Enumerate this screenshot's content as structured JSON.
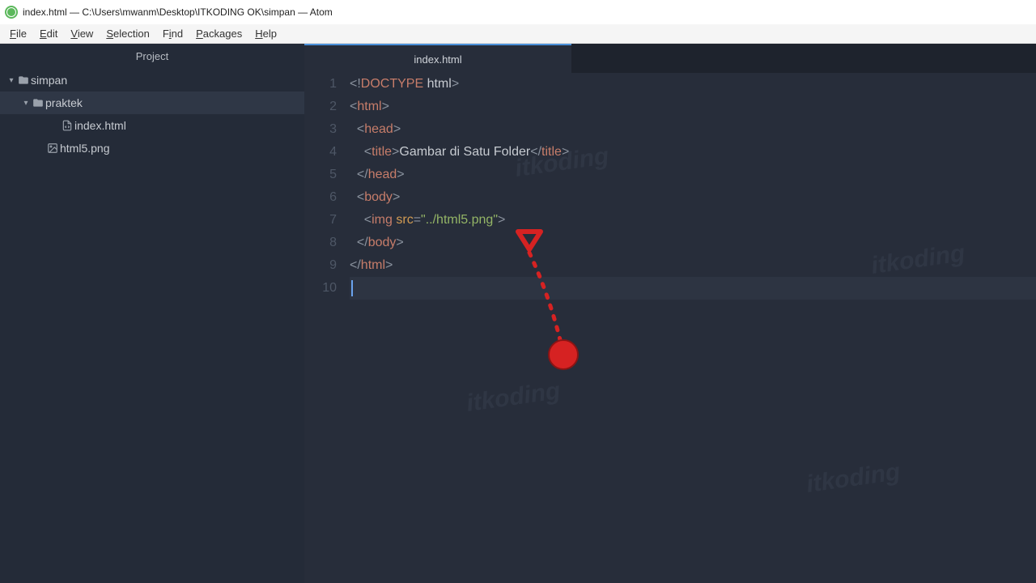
{
  "window": {
    "title": "index.html — C:\\Users\\mwanm\\Desktop\\ITKODING OK\\simpan — Atom"
  },
  "menu": {
    "file": "File",
    "edit": "Edit",
    "view": "View",
    "selection": "Selection",
    "find": "Find",
    "packages": "Packages",
    "help": "Help"
  },
  "sidebar": {
    "header": "Project",
    "items": [
      {
        "label": "simpan",
        "type": "folder",
        "indent": 0,
        "chev": "▾"
      },
      {
        "label": "praktek",
        "type": "folder",
        "indent": 1,
        "chev": "▾",
        "selected": true
      },
      {
        "label": "index.html",
        "type": "file-code",
        "indent": 2
      },
      {
        "label": "html5.png",
        "type": "file-image",
        "indent": 1
      }
    ]
  },
  "tab": {
    "label": "index.html"
  },
  "code": {
    "lines": [
      {
        "n": "1",
        "segs": [
          {
            "c": "p",
            "t": "<!"
          },
          {
            "c": "t",
            "t": "DOCTYPE"
          },
          {
            "c": "tx",
            "t": " html"
          },
          {
            "c": "p",
            "t": ">"
          }
        ]
      },
      {
        "n": "2",
        "segs": [
          {
            "c": "p",
            "t": "<"
          },
          {
            "c": "t",
            "t": "html"
          },
          {
            "c": "p",
            "t": ">"
          }
        ]
      },
      {
        "n": "3",
        "segs": [
          {
            "c": "tx",
            "t": "  "
          },
          {
            "c": "p",
            "t": "<"
          },
          {
            "c": "t",
            "t": "head"
          },
          {
            "c": "p",
            "t": ">"
          }
        ]
      },
      {
        "n": "4",
        "segs": [
          {
            "c": "tx",
            "t": "    "
          },
          {
            "c": "p",
            "t": "<"
          },
          {
            "c": "t",
            "t": "title"
          },
          {
            "c": "p",
            "t": ">"
          },
          {
            "c": "tx",
            "t": "Gambar di Satu Folder"
          },
          {
            "c": "p",
            "t": "</"
          },
          {
            "c": "t",
            "t": "title"
          },
          {
            "c": "p",
            "t": ">"
          }
        ]
      },
      {
        "n": "5",
        "segs": [
          {
            "c": "tx",
            "t": "  "
          },
          {
            "c": "p",
            "t": "</"
          },
          {
            "c": "t",
            "t": "head"
          },
          {
            "c": "p",
            "t": ">"
          }
        ]
      },
      {
        "n": "6",
        "segs": [
          {
            "c": "tx",
            "t": "  "
          },
          {
            "c": "p",
            "t": "<"
          },
          {
            "c": "t",
            "t": "body"
          },
          {
            "c": "p",
            "t": ">"
          }
        ]
      },
      {
        "n": "7",
        "segs": [
          {
            "c": "tx",
            "t": "    "
          },
          {
            "c": "p",
            "t": "<"
          },
          {
            "c": "t",
            "t": "img"
          },
          {
            "c": "tx",
            "t": " "
          },
          {
            "c": "a",
            "t": "src"
          },
          {
            "c": "p",
            "t": "="
          },
          {
            "c": "s",
            "t": "\"../html5.png\""
          },
          {
            "c": "p",
            "t": ">"
          }
        ]
      },
      {
        "n": "8",
        "segs": [
          {
            "c": "tx",
            "t": "  "
          },
          {
            "c": "p",
            "t": "</"
          },
          {
            "c": "t",
            "t": "body"
          },
          {
            "c": "p",
            "t": ">"
          }
        ]
      },
      {
        "n": "9",
        "segs": [
          {
            "c": "p",
            "t": "</"
          },
          {
            "c": "t",
            "t": "html"
          },
          {
            "c": "p",
            "t": ">"
          }
        ]
      },
      {
        "n": "10",
        "segs": [],
        "current": true
      }
    ]
  },
  "watermark": "itkoding"
}
